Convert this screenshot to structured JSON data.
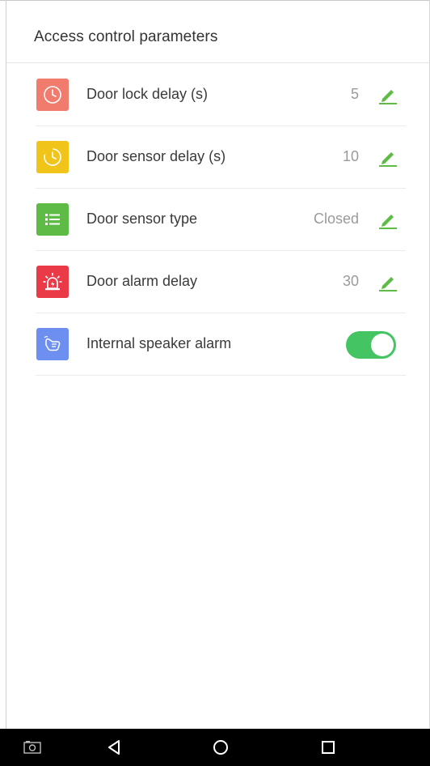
{
  "header": {
    "title": "Access control parameters"
  },
  "rows": [
    {
      "label": "Door lock delay (s)",
      "value": "5",
      "icon": "clock-icon",
      "icon_color": "#f17c6e"
    },
    {
      "label": "Door sensor delay (s)",
      "value": "10",
      "icon": "clock-icon",
      "icon_color": "#f0c419"
    },
    {
      "label": "Door sensor type",
      "value": "Closed",
      "icon": "list-icon",
      "icon_color": "#5dbb46"
    },
    {
      "label": "Door alarm delay",
      "value": "30",
      "icon": "alarm-light-icon",
      "icon_color": "#ea3a48"
    },
    {
      "label": "Internal speaker alarm",
      "icon": "hand-icon",
      "icon_color": "#6d8ff0",
      "toggle_on": true
    }
  ],
  "colors": {
    "accent": "#5dbb46",
    "toggle_on": "#44c463"
  },
  "navbar": {
    "items": [
      "screenshot-icon",
      "back-icon",
      "home-icon",
      "recents-icon"
    ]
  }
}
